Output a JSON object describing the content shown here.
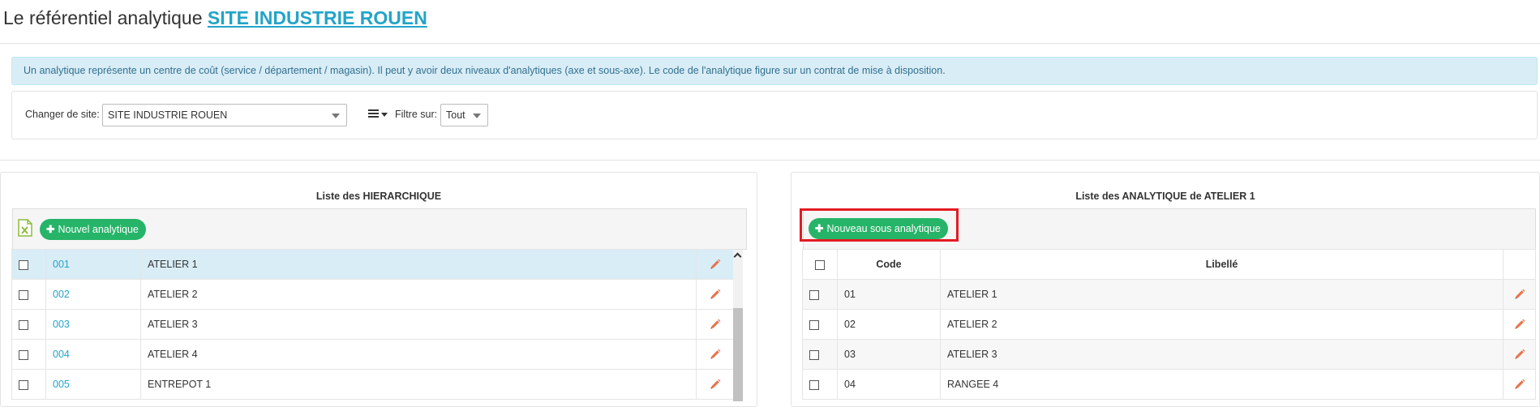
{
  "header": {
    "title_prefix": "Le référentiel analytique",
    "site_name": "SITE INDUSTRIE ROUEN"
  },
  "info_text": "Un analytique représente un centre de coût (service / département / magasin). Il peut y avoir deux niveaux d'analytiques (axe et sous-axe). Le code de l'analytique figure sur un contrat de mise à disposition.",
  "filters": {
    "site_label": "Changer de site:",
    "site_value": "SITE INDUSTRIE ROUEN",
    "filter_label": "Filtre sur:",
    "filter_value": "Tout",
    "menu_icon": "hamburger-menu-icon"
  },
  "left_panel": {
    "title": "Liste des HIERARCHIQUE",
    "export_icon": "excel-icon",
    "new_button": "Nouvel analytique",
    "rows": [
      {
        "code": "001",
        "label": "ATELIER 1"
      },
      {
        "code": "002",
        "label": "ATELIER 2"
      },
      {
        "code": "003",
        "label": "ATELIER 3"
      },
      {
        "code": "004",
        "label": "ATELIER 4"
      },
      {
        "code": "005",
        "label": "ENTREPOT 1"
      }
    ]
  },
  "right_panel": {
    "title": "Liste des ANALYTIQUE de ATELIER 1",
    "new_button": "Nouveau sous analytique",
    "columns": {
      "code": "Code",
      "label": "Libellé"
    },
    "rows": [
      {
        "code": "01",
        "label": "ATELIER 1"
      },
      {
        "code": "02",
        "label": "ATELIER 2"
      },
      {
        "code": "03",
        "label": "ATELIER 3"
      },
      {
        "code": "04",
        "label": "RANGEE 4"
      }
    ]
  },
  "colors": {
    "accent": "#23a4c8",
    "button_green": "#26b468",
    "edit_icon": "#e8734a",
    "highlight": "#e31b23",
    "info_bg": "#d9edf7"
  }
}
